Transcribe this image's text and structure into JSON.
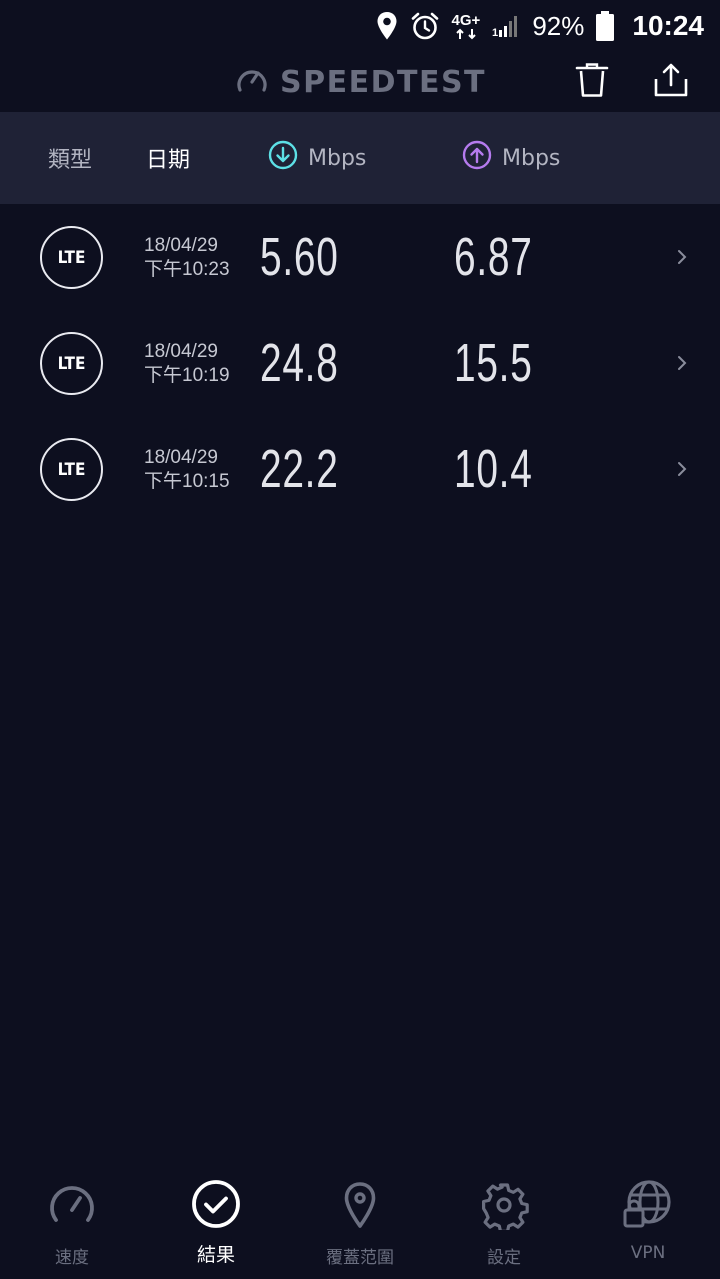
{
  "status_bar": {
    "network": "4G+",
    "battery": "92%",
    "time": "10:24"
  },
  "header": {
    "title": "SPEEDTEST"
  },
  "columns": {
    "type": "類型",
    "date": "日期",
    "download_unit": "Mbps",
    "upload_unit": "Mbps"
  },
  "results": [
    {
      "type": "LTE",
      "date": "18/04/29",
      "time": "下午10:23",
      "download": "5.60",
      "upload": "6.87"
    },
    {
      "type": "LTE",
      "date": "18/04/29",
      "time": "下午10:19",
      "download": "24.8",
      "upload": "15.5"
    },
    {
      "type": "LTE",
      "date": "18/04/29",
      "time": "下午10:15",
      "download": "22.2",
      "upload": "10.4"
    }
  ],
  "nav": {
    "items": [
      {
        "label": "速度",
        "icon": "speedometer-icon"
      },
      {
        "label": "結果",
        "icon": "check-circle-icon"
      },
      {
        "label": "覆蓋范圍",
        "icon": "map-pin-icon"
      },
      {
        "label": "設定",
        "icon": "gear-icon"
      },
      {
        "label": "VPN",
        "icon": "vpn-globe-lock-icon"
      }
    ],
    "active_index": 1
  },
  "colors": {
    "background": "#0d0f1f",
    "header_bar": "#1f2236",
    "download_accent": "#5de0e6",
    "upload_accent": "#b57bee",
    "muted": "#6b6f80"
  }
}
